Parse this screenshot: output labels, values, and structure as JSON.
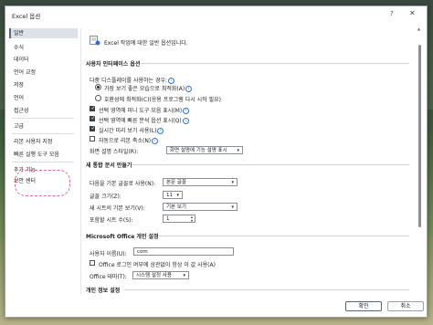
{
  "window": {
    "title": "Excel 옵션",
    "help": "?",
    "close": "✕"
  },
  "sidebar": {
    "items": [
      {
        "label": "일반"
      },
      {
        "label": "수식"
      },
      {
        "label": "데이터"
      },
      {
        "label": "언어 교정"
      },
      {
        "label": "저장"
      },
      {
        "label": "언어"
      },
      {
        "label": "접근성"
      },
      {
        "label": "고급"
      },
      {
        "label": "리본 사용자 지정"
      },
      {
        "label": "빠른 실행 도구 모음"
      },
      {
        "label": "추가 기능"
      },
      {
        "label": "보안 센터"
      }
    ]
  },
  "main": {
    "intro": "Excel 작업에 대한 일반 옵션입니다.",
    "ui_section": {
      "title": "사용자 인터페이스 옵션",
      "multi_display_label": "다중 디스플레이를 사용하는 경우:",
      "radio_appearance": "가장 보기 좋은 모습으로 최적화(A)",
      "radio_compat": "호환성에 최적화(C)(응용 프로그램 다시 시작 필요)",
      "cb_mini_toolbar": "선택 영역에 미니 도구 모음 표시(M)",
      "cb_quick_analysis": "선택 영역에 빠른 분석 옵션 표시(Q)",
      "cb_live_preview": "실시간 미리 보기 사용(L)",
      "cb_collapse_ribbon": "자동으로 리본 축소(N)",
      "tooltip_style_label": "화면 설명 스타일(R):",
      "tooltip_style_value": "화면 설명에 기능 설명 표시"
    },
    "new_workbook_section": {
      "title": "새 통합 문서 만들기",
      "default_font_label": "다음을 기본 글꼴로 사용(N):",
      "default_font_value": "본문 글꼴",
      "font_size_label": "글꼴 크기(Z):",
      "font_size_value": "11",
      "default_view_label": "새 시트의 기본 보기(V):",
      "default_view_value": "기본 보기",
      "sheet_count_label": "포함할 시트 수(S):",
      "sheet_count_value": "1"
    },
    "personalize_section": {
      "title": "Microsoft Office 개인 설정",
      "username_label": "사용자 이름(U):",
      "username_value": "com",
      "always_use_label": "Office 로그인 여부에 상관없이 항상 이 값 사용(A)",
      "theme_label": "Office 테마(T):",
      "theme_value": "시스템 설정 사용"
    },
    "privacy_section": {
      "title": "개인 정보 설정"
    }
  },
  "footer": {
    "ok": "확인",
    "cancel": "취소"
  },
  "colors": {
    "highlight": "#e8679a",
    "info": "#2a6fd6"
  }
}
